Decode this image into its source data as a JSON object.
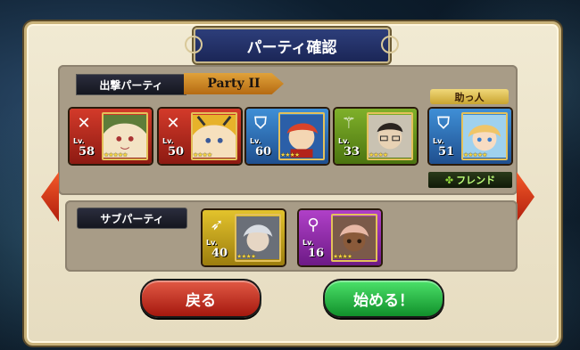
{
  "title": "パーティ確認",
  "main_party": {
    "label": "出撃パーティ",
    "name": "Party II",
    "members": [
      {
        "class_icon": "crossed-swords-icon",
        "color": "#d33a2a",
        "lv_label": "Lv.",
        "level": "58",
        "stars": "★★★★★"
      },
      {
        "class_icon": "crossed-swords-icon",
        "color": "#d33a2a",
        "lv_label": "Lv.",
        "level": "50",
        "stars": "★★★★"
      },
      {
        "class_icon": "shield-icon",
        "color": "#3f8fd6",
        "lv_label": "Lv.",
        "level": "60",
        "stars": "★★★★"
      },
      {
        "class_icon": "staff-icon",
        "color": "#7fb02a",
        "lv_label": "Lv.",
        "level": "33",
        "stars": "★★★★"
      }
    ]
  },
  "helper": {
    "label": "助っ人",
    "member": {
      "class_icon": "shield-icon",
      "color": "#3f8fd6",
      "lv_label": "Lv.",
      "level": "51",
      "stars": "★★★★★"
    },
    "tag": "フレンド",
    "tag_icon": "clover-icon"
  },
  "sub_party": {
    "label": "サブパーティ",
    "members": [
      {
        "class_icon": "bow-icon",
        "color": "#e3c32c",
        "lv_label": "Lv.",
        "level": "40",
        "stars": "★★★★"
      },
      {
        "class_icon": "wand-icon",
        "color": "#b040c8",
        "lv_label": "Lv.",
        "level": "16",
        "stars": "★★★★"
      }
    ]
  },
  "buttons": {
    "back": "戻る",
    "start": "始める！"
  }
}
